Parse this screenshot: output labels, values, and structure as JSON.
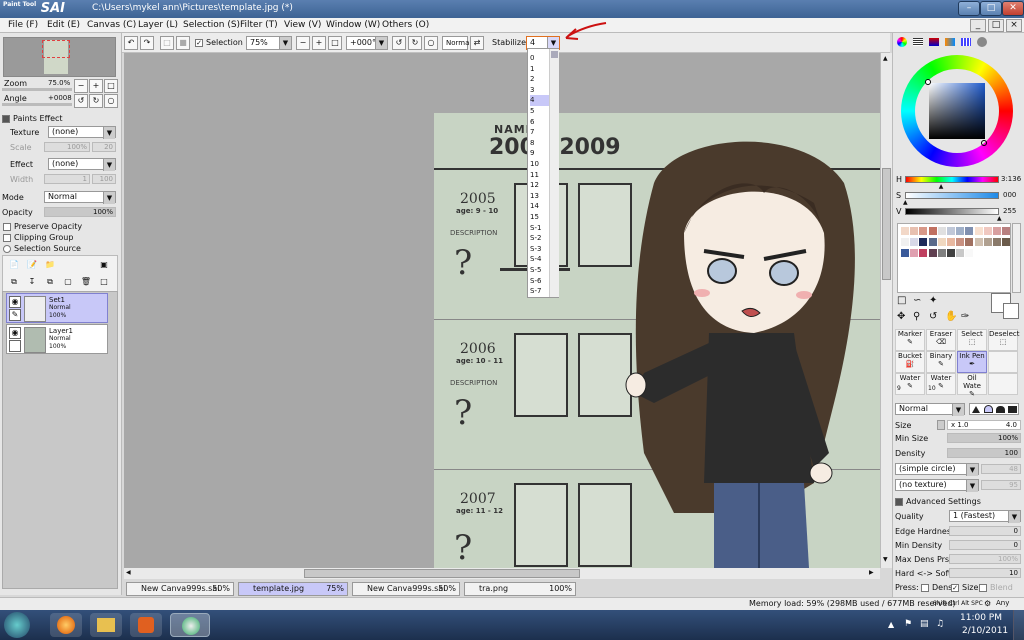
{
  "app": {
    "logo_text": "SAI",
    "logo_sub": "Paint Tool",
    "window_title": "C:\\Users\\mykel ann\\Pictures\\template.jpg (*)"
  },
  "menu": [
    "File (F)",
    "Edit (E)",
    "Canvas (C)",
    "Layer (L)",
    "Selection (S)",
    "Filter (T)",
    "View (V)",
    "Window (W)",
    "Others (O)"
  ],
  "toolbar": {
    "selection_label": "Selection",
    "zoom_value": "75%",
    "angle_value": "+000°",
    "blend_mode": "Normal",
    "stabilizer_label": "Stabilizer",
    "stabilizer_value": "4"
  },
  "stabilizer_options": [
    "0",
    "1",
    "2",
    "3",
    "4",
    "5",
    "6",
    "7",
    "8",
    "9",
    "10",
    "11",
    "12",
    "13",
    "14",
    "15",
    "S-1",
    "S-2",
    "S-3",
    "S-4",
    "S-5",
    "S-6",
    "S-7"
  ],
  "stabilizer_selected": "4",
  "navigator": {
    "zoom_label": "Zoom",
    "zoom_value": "75.0%",
    "angle_label": "Angle",
    "angle_value": "+0008"
  },
  "paper_effect": {
    "header": "Paints Effect",
    "texture_label": "Texture",
    "texture_value": "(none)",
    "scale_label": "Scale",
    "scale_value": "100%",
    "scale_num": "20",
    "effect_label": "Effect",
    "effect_value": "(none)",
    "width_label": "Width",
    "width_value": "1",
    "width_num": "100"
  },
  "layer_props": {
    "mode_label": "Mode",
    "mode_value": "Normal",
    "opacity_label": "Opacity",
    "opacity_value": "100%",
    "preserve_opacity": "Preserve Opacity",
    "clipping_group": "Clipping Group",
    "selection_source": "Selection Source"
  },
  "layers": [
    {
      "name": "Set1",
      "mode": "Normal",
      "opacity": "100%"
    },
    {
      "name": "Layer1",
      "mode": "Normal",
      "opacity": "100%"
    }
  ],
  "artwork": {
    "header_name": "NAME",
    "header_years": "2003-2009",
    "rows": [
      {
        "year": "2005",
        "age": "age: 9 - 10",
        "desc": "DESCRIPTION"
      },
      {
        "year": "2006",
        "age": "age: 10 - 11",
        "desc": "DESCRIPTION"
      },
      {
        "year": "2007",
        "age": "age: 11 - 12",
        "desc": ""
      }
    ]
  },
  "tabs": [
    {
      "label": "New Canva999s.sai",
      "pct": "50%"
    },
    {
      "label": "template.jpg",
      "pct": "75%"
    },
    {
      "label": "New Canva999s.sai",
      "pct": "50%"
    },
    {
      "label": "tra.png",
      "pct": "100%"
    }
  ],
  "statusbar": {
    "memory": "Memory load: 59% (298MB used / 677MB reserved)",
    "keys": "Shift Ctrl Alt SPC",
    "any": "Any"
  },
  "color": {
    "h_label": "H",
    "h_value": "3:136",
    "s_label": "S",
    "s_value": "000",
    "v_label": "V",
    "v_value": "255",
    "h_pos": 0.38,
    "s_pos": 0.0,
    "v_pos": 1.0
  },
  "tools": [
    {
      "label": "Marker"
    },
    {
      "label": "Eraser"
    },
    {
      "label": "Select"
    },
    {
      "label": "Deselect"
    },
    {
      "label": "Bucket"
    },
    {
      "label": "Binary"
    },
    {
      "label": "Ink Pen"
    },
    {
      "label": ""
    },
    {
      "label": "Water"
    },
    {
      "label": "Water"
    },
    {
      "label": "Oil Wate"
    },
    {
      "label": ""
    }
  ],
  "tool_nums": [
    "9",
    "10"
  ],
  "brush": {
    "mode_value": "Normal",
    "size_label": "Size",
    "size_mult": "x 1.0",
    "size_value": "4.0",
    "minsize_label": "Min Size",
    "minsize_value": "100%",
    "density_label": "Density",
    "density_value": "100",
    "shape_value": "(simple circle)",
    "shape_num": "48",
    "texture_value": "(no texture)",
    "texture_num": "95",
    "advanced_header": "Advanced Settings",
    "quality_label": "Quality",
    "quality_value": "1 (Fastest)",
    "edge_label": "Edge Hardness",
    "edge_value": "0",
    "mindens_label": "Min Density",
    "mindens_value": "0",
    "maxdens_label": "Max Dens Prs.",
    "maxdens_value": "100%",
    "hardsoft_label": "Hard <-> Soft",
    "hardsoft_value": "10",
    "press_label": "Press:",
    "press_dens": "Dens",
    "press_size": "Size",
    "press_blend": "Blend"
  },
  "clock": {
    "time": "11:00 PM",
    "date": "2/10/2011"
  }
}
